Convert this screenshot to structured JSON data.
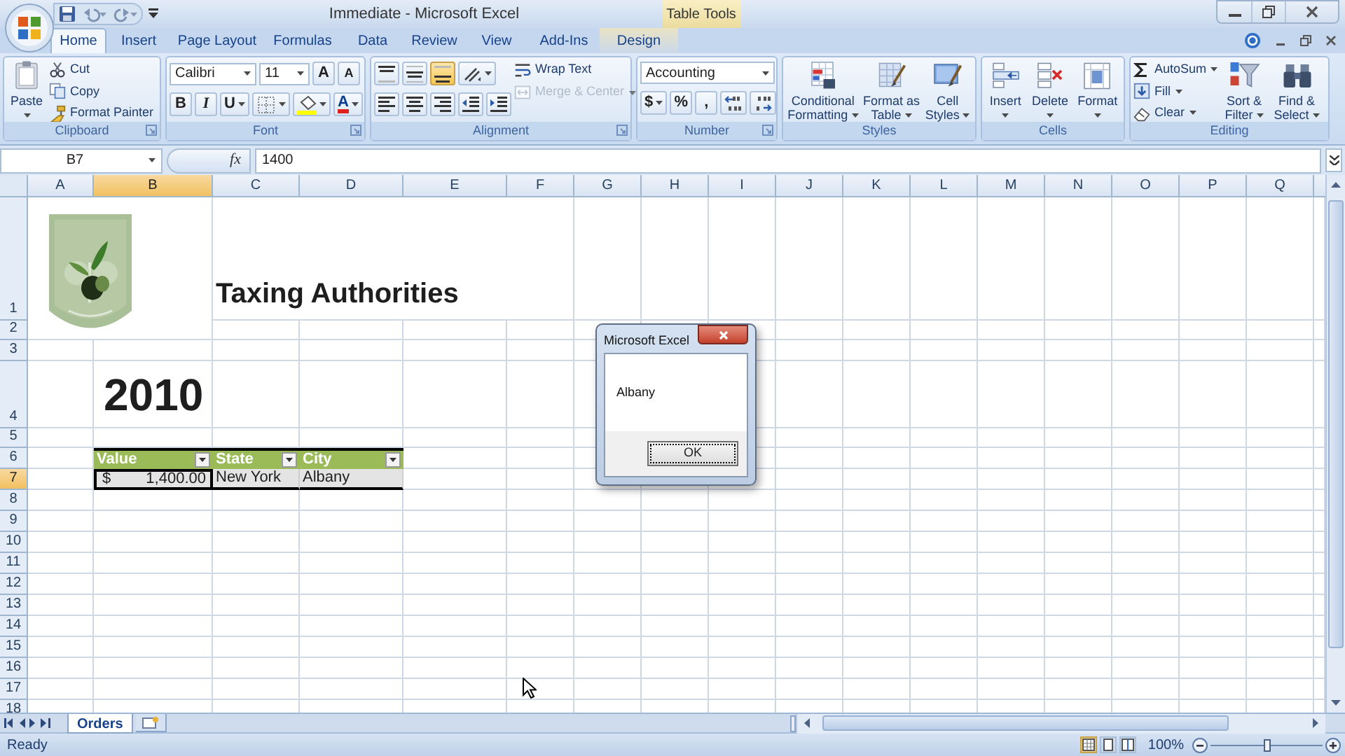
{
  "title_bar": {
    "title": "Immediate - Microsoft Excel",
    "contextual": "Table Tools"
  },
  "tabs": [
    {
      "label": "Home",
      "selected": true,
      "kind": "normal"
    },
    {
      "label": "Insert",
      "selected": false,
      "kind": "normal"
    },
    {
      "label": "Page Layout",
      "selected": false,
      "kind": "normal"
    },
    {
      "label": "Formulas",
      "selected": false,
      "kind": "normal"
    },
    {
      "label": "Data",
      "selected": false,
      "kind": "normal"
    },
    {
      "label": "Review",
      "selected": false,
      "kind": "normal"
    },
    {
      "label": "View",
      "selected": false,
      "kind": "normal"
    },
    {
      "label": "Add-Ins",
      "selected": false,
      "kind": "normal"
    },
    {
      "label": "Design",
      "selected": false,
      "kind": "contextual"
    }
  ],
  "ribbon": [
    {
      "label": "Clipboard",
      "launcher": true,
      "columns": [
        {
          "kind": "large",
          "label": "Paste",
          "dropdown": true
        },
        {
          "kind": "stack",
          "items": [
            {
              "label": "Cut",
              "disabled": false,
              "dropdown": false
            },
            {
              "label": "Copy",
              "disabled": false,
              "dropdown": false
            },
            {
              "label": "Format Painter",
              "disabled": false,
              "dropdown": false
            }
          ]
        }
      ]
    },
    {
      "label": "Font",
      "launcher": true,
      "columns": [
        {
          "kind": "lines",
          "lines": [
            {
              "items": [
                {
                  "kind": "combo",
                  "value": "Calibri"
                },
                {
                  "kind": "combo",
                  "value": "11"
                },
                {
                  "kind": "tool",
                  "label": "A",
                  "selected": false,
                  "dropdown": false
                },
                {
                  "kind": "tool",
                  "label": "A",
                  "selected": false,
                  "dropdown": false
                }
              ]
            },
            {
              "items": [
                {
                  "kind": "tool",
                  "label": "B",
                  "selected": false,
                  "dropdown": false
                },
                {
                  "kind": "tool",
                  "label": "I",
                  "selected": false,
                  "dropdown": false
                },
                {
                  "kind": "tool",
                  "label": "U",
                  "selected": false,
                  "dropdown": true
                },
                {
                  "kind": "tool",
                  "selected": false,
                  "dropdown": true
                },
                {
                  "kind": "tool",
                  "selected": false,
                  "dropdown": true
                },
                {
                  "kind": "tool",
                  "label": "A",
                  "selected": false,
                  "dropdown": true
                }
              ]
            }
          ]
        }
      ]
    },
    {
      "label": "Alignment",
      "launcher": true,
      "columns": [
        {
          "kind": "lines",
          "lines": [
            {
              "items": [
                {
                  "kind": "tool",
                  "selected": false,
                  "dropdown": false
                },
                {
                  "kind": "tool",
                  "selected": false,
                  "dropdown": false
                },
                {
                  "kind": "tool",
                  "selected": true,
                  "dropdown": false
                },
                {
                  "kind": "tool",
                  "selected": false,
                  "dropdown": true
                }
              ]
            },
            {
              "items": [
                {
                  "kind": "tool",
                  "selected": false,
                  "dropdown": false
                },
                {
                  "kind": "tool",
                  "selected": false,
                  "dropdown": false
                },
                {
                  "kind": "tool",
                  "selected": false,
                  "dropdown": false
                },
                {
                  "kind": "tool",
                  "selected": false,
                  "dropdown": false
                },
                {
                  "kind": "tool",
                  "selected": false,
                  "dropdown": false
                }
              ]
            }
          ]
        },
        {
          "kind": "stack",
          "items": [
            {
              "label": "Wrap Text",
              "disabled": false,
              "dropdown": false
            },
            {
              "label": "Merge & Center",
              "disabled": true,
              "dropdown": true
            }
          ]
        }
      ]
    },
    {
      "label": "Number",
      "launcher": true,
      "columns": [
        {
          "kind": "lines",
          "lines": [
            {
              "items": [
                {
                  "kind": "combo",
                  "value": "Accounting"
                }
              ]
            },
            {
              "items": [
                {
                  "kind": "tool",
                  "label": "$",
                  "selected": false,
                  "dropdown": true
                },
                {
                  "kind": "tool",
                  "label": "%",
                  "selected": false,
                  "dropdown": false
                },
                {
                  "kind": "tool",
                  "label": ",",
                  "selected": false,
                  "dropdown": false
                },
                {
                  "kind": "tool",
                  "selected": false,
                  "dropdown": false
                },
                {
                  "kind": "tool",
                  "selected": false,
                  "dropdown": false
                }
              ]
            }
          ]
        }
      ]
    },
    {
      "label": "Styles",
      "launcher": false,
      "columns": [
        {
          "kind": "large",
          "label": "Conditional Formatting",
          "dropdown": true
        },
        {
          "kind": "large",
          "label": "Format as Table",
          "dropdown": true
        },
        {
          "kind": "large",
          "label": "Cell Styles",
          "dropdown": true
        }
      ]
    },
    {
      "label": "Cells",
      "launcher": false,
      "columns": [
        {
          "kind": "large",
          "label": "Insert",
          "dropdown": true
        },
        {
          "kind": "large",
          "label": "Delete",
          "dropdown": true
        },
        {
          "kind": "large",
          "label": "Format",
          "dropdown": true
        }
      ]
    },
    {
      "label": "Editing",
      "launcher": false,
      "columns": [
        {
          "kind": "stack",
          "items": [
            {
              "label": "AutoSum",
              "disabled": false,
              "dropdown": true
            },
            {
              "label": "Fill",
              "disabled": false,
              "dropdown": true
            },
            {
              "label": "Clear",
              "disabled": false,
              "dropdown": true
            }
          ]
        },
        {
          "kind": "large",
          "label": "Sort & Filter",
          "dropdown": true
        },
        {
          "kind": "large",
          "label": "Find & Select",
          "dropdown": true
        }
      ]
    }
  ],
  "formula_bar": {
    "name_box": "B7",
    "function_label": "fx",
    "value": "1400"
  },
  "sheet": {
    "columns": [
      {
        "label": "A",
        "selected": false
      },
      {
        "label": "B",
        "selected": true
      },
      {
        "label": "C",
        "selected": false
      },
      {
        "label": "D",
        "selected": false
      },
      {
        "label": "E",
        "selected": false
      },
      {
        "label": "F",
        "selected": false
      },
      {
        "label": "G",
        "selected": false
      },
      {
        "label": "H",
        "selected": false
      },
      {
        "label": "I",
        "selected": false
      },
      {
        "label": "J",
        "selected": false
      },
      {
        "label": "K",
        "selected": false
      },
      {
        "label": "L",
        "selected": false
      },
      {
        "label": "M",
        "selected": false
      },
      {
        "label": "N",
        "selected": false
      },
      {
        "label": "O",
        "selected": false
      },
      {
        "label": "P",
        "selected": false
      },
      {
        "label": "Q",
        "selected": false
      }
    ],
    "rows": [
      {
        "label": "1",
        "selected": false
      },
      {
        "label": "2",
        "selected": false
      },
      {
        "label": "3",
        "selected": false
      },
      {
        "label": "4",
        "selected": false
      },
      {
        "label": "5",
        "selected": false
      },
      {
        "label": "6",
        "selected": false
      },
      {
        "label": "7",
        "selected": true
      },
      {
        "label": "8",
        "selected": false
      },
      {
        "label": "9",
        "selected": false
      },
      {
        "label": "10",
        "selected": false
      },
      {
        "label": "11",
        "selected": false
      },
      {
        "label": "12",
        "selected": false
      },
      {
        "label": "13",
        "selected": false
      },
      {
        "label": "14",
        "selected": false
      },
      {
        "label": "15",
        "selected": false
      },
      {
        "label": "16",
        "selected": false
      },
      {
        "label": "17",
        "selected": false
      },
      {
        "label": "18",
        "selected": false
      }
    ],
    "title": "Taxing Authorities",
    "year": "2010",
    "table": {
      "columns": [
        {
          "label": "Value"
        },
        {
          "label": "State"
        },
        {
          "label": "City"
        }
      ],
      "cells": [
        {
          "currency": "$",
          "text": "1,400.00",
          "selected": true
        },
        {
          "text": "New York",
          "selected": false
        },
        {
          "text": "Albany",
          "selected": false
        }
      ]
    }
  },
  "dialog": {
    "title": "Microsoft Excel",
    "message": "Albany",
    "button": "OK"
  },
  "sheet_tabs": [
    {
      "label": "Orders",
      "selected": true
    }
  ],
  "status_bar": {
    "status": "Ready",
    "zoom": {
      "label": "100%",
      "level": 0.5
    }
  }
}
